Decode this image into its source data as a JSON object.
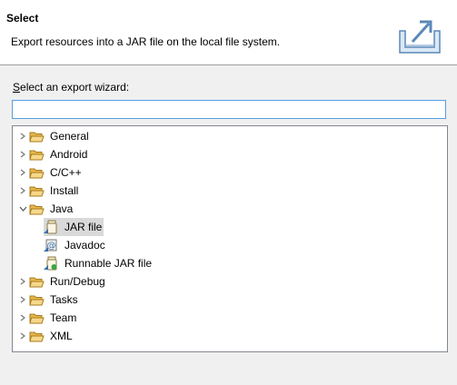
{
  "header": {
    "title": "Select",
    "description": "Export resources into a JAR file on the local file system."
  },
  "wizard": {
    "label_mnemonic": "S",
    "label_rest": "elect an export wizard:",
    "filter_value": ""
  },
  "tree": {
    "general": "General",
    "android": "Android",
    "cpp": "C/C++",
    "install": "Install",
    "java": "Java",
    "jar_file": "JAR file",
    "javadoc": "Javadoc",
    "runnable_jar": "Runnable JAR file",
    "run_debug": "Run/Debug",
    "tasks": "Tasks",
    "team": "Team",
    "xml": "XML"
  },
  "icons": {
    "folder": "folder-icon",
    "jar": "jar-file-icon",
    "javadoc": "javadoc-icon",
    "runnable_jar": "runnable-jar-icon",
    "export": "export-icon"
  },
  "colors": {
    "folder": "#e8b84a",
    "selection": "#d9d9d9",
    "input_border": "#569de5"
  },
  "state": {
    "expanded": "Java",
    "selected": "JAR file"
  }
}
